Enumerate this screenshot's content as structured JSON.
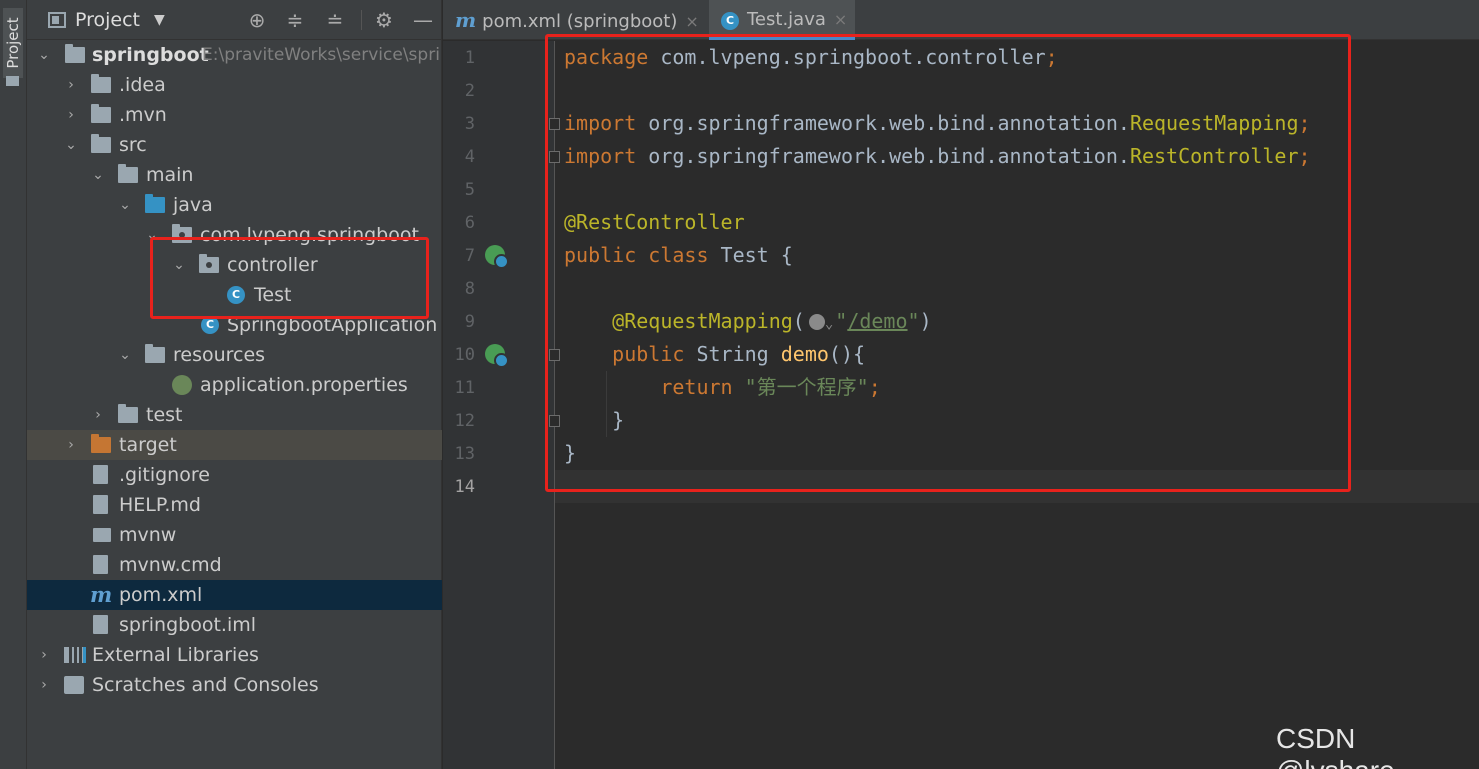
{
  "toolstrip": {
    "label": "Project"
  },
  "panel": {
    "title": "Project",
    "tree": [
      {
        "label": "springboot",
        "extra": "E:\\praviteWorks\\service\\spri"
      },
      {
        "label": ".idea"
      },
      {
        "label": ".mvn"
      },
      {
        "label": "src"
      },
      {
        "label": "main"
      },
      {
        "label": "java"
      },
      {
        "label": "com.lvpeng.springboot"
      },
      {
        "label": "controller"
      },
      {
        "label": "Test"
      },
      {
        "label": "SpringbootApplication"
      },
      {
        "label": "resources"
      },
      {
        "label": "application.properties"
      },
      {
        "label": "test"
      },
      {
        "label": "target"
      },
      {
        "label": ".gitignore"
      },
      {
        "label": "HELP.md"
      },
      {
        "label": "mvnw"
      },
      {
        "label": "mvnw.cmd"
      },
      {
        "label": "pom.xml"
      },
      {
        "label": "springboot.iml"
      },
      {
        "label": "External Libraries"
      },
      {
        "label": "Scratches and Consoles"
      }
    ]
  },
  "tabs": [
    {
      "label": "pom.xml (springboot)",
      "icon": "maven-icon",
      "close": "×"
    },
    {
      "label": "Test.java",
      "icon": "class-icon",
      "close": "×"
    }
  ],
  "editor": {
    "line_numbers": [
      "1",
      "2",
      "3",
      "4",
      "5",
      "6",
      "7",
      "8",
      "9",
      "10",
      "11",
      "12",
      "13",
      "14"
    ],
    "code": {
      "l1_kw": "package",
      "l1_rest": " com.lvpeng.springboot.controller",
      "l1_semi": ";",
      "l3_kw": "import",
      "l3_rest": " org.springframework.web.bind.annotation.",
      "l3_cls": "RequestMapping",
      "l3_semi": ";",
      "l4_kw": "import",
      "l4_rest": " org.springframework.web.bind.annotation.",
      "l4_cls": "RestController",
      "l4_semi": ";",
      "l6_ann": "@RestController",
      "l7_kw": "public class",
      "l7_rest": " Test {",
      "l9_ann": "    @RequestMapping",
      "l9_open": "(",
      "l9_hint": "⌄",
      "l9_q1": "\"",
      "l9_path": "/demo",
      "l9_q2": "\"",
      "l9_close": ")",
      "l10_kw": "    public",
      "l10_type": " String ",
      "l10_fn": "demo",
      "l10_rest": "(){",
      "l11_kw": "        return",
      "l11_str": " \"第一个程序\"",
      "l11_semi": ";",
      "l12": "    }",
      "l13": "}"
    }
  },
  "watermark": "CSDN @lvshare",
  "colors": {
    "background": "#2b2b2b",
    "panel": "#3c3f41",
    "keyword": "#cc7832",
    "annotation": "#bbb529",
    "string": "#6a8759",
    "function": "#ffc66d",
    "highlight_box": "#e8221c",
    "selection": "#0d293e"
  }
}
